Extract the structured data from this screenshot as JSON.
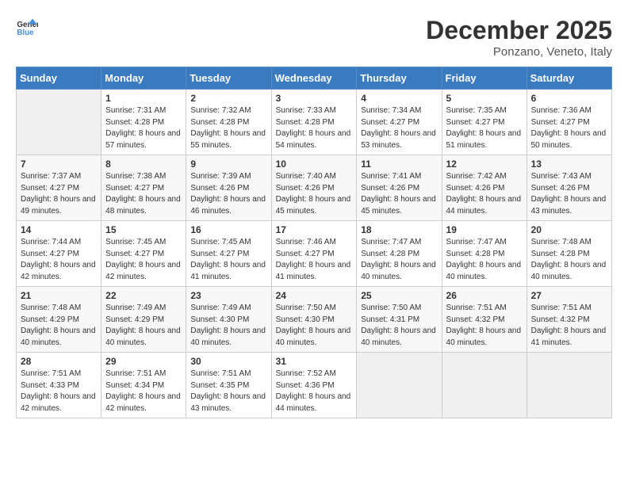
{
  "header": {
    "logo_general": "General",
    "logo_blue": "Blue",
    "month_title": "December 2025",
    "location": "Ponzano, Veneto, Italy"
  },
  "days_of_week": [
    "Sunday",
    "Monday",
    "Tuesday",
    "Wednesday",
    "Thursday",
    "Friday",
    "Saturday"
  ],
  "weeks": [
    [
      {
        "day": "",
        "sunrise": "",
        "sunset": "",
        "daylight": "",
        "empty": true
      },
      {
        "day": "1",
        "sunrise": "Sunrise: 7:31 AM",
        "sunset": "Sunset: 4:28 PM",
        "daylight": "Daylight: 8 hours and 57 minutes."
      },
      {
        "day": "2",
        "sunrise": "Sunrise: 7:32 AM",
        "sunset": "Sunset: 4:28 PM",
        "daylight": "Daylight: 8 hours and 55 minutes."
      },
      {
        "day": "3",
        "sunrise": "Sunrise: 7:33 AM",
        "sunset": "Sunset: 4:28 PM",
        "daylight": "Daylight: 8 hours and 54 minutes."
      },
      {
        "day": "4",
        "sunrise": "Sunrise: 7:34 AM",
        "sunset": "Sunset: 4:27 PM",
        "daylight": "Daylight: 8 hours and 53 minutes."
      },
      {
        "day": "5",
        "sunrise": "Sunrise: 7:35 AM",
        "sunset": "Sunset: 4:27 PM",
        "daylight": "Daylight: 8 hours and 51 minutes."
      },
      {
        "day": "6",
        "sunrise": "Sunrise: 7:36 AM",
        "sunset": "Sunset: 4:27 PM",
        "daylight": "Daylight: 8 hours and 50 minutes."
      }
    ],
    [
      {
        "day": "7",
        "sunrise": "Sunrise: 7:37 AM",
        "sunset": "Sunset: 4:27 PM",
        "daylight": "Daylight: 8 hours and 49 minutes."
      },
      {
        "day": "8",
        "sunrise": "Sunrise: 7:38 AM",
        "sunset": "Sunset: 4:27 PM",
        "daylight": "Daylight: 8 hours and 48 minutes."
      },
      {
        "day": "9",
        "sunrise": "Sunrise: 7:39 AM",
        "sunset": "Sunset: 4:26 PM",
        "daylight": "Daylight: 8 hours and 46 minutes."
      },
      {
        "day": "10",
        "sunrise": "Sunrise: 7:40 AM",
        "sunset": "Sunset: 4:26 PM",
        "daylight": "Daylight: 8 hours and 45 minutes."
      },
      {
        "day": "11",
        "sunrise": "Sunrise: 7:41 AM",
        "sunset": "Sunset: 4:26 PM",
        "daylight": "Daylight: 8 hours and 45 minutes."
      },
      {
        "day": "12",
        "sunrise": "Sunrise: 7:42 AM",
        "sunset": "Sunset: 4:26 PM",
        "daylight": "Daylight: 8 hours and 44 minutes."
      },
      {
        "day": "13",
        "sunrise": "Sunrise: 7:43 AM",
        "sunset": "Sunset: 4:26 PM",
        "daylight": "Daylight: 8 hours and 43 minutes."
      }
    ],
    [
      {
        "day": "14",
        "sunrise": "Sunrise: 7:44 AM",
        "sunset": "Sunset: 4:27 PM",
        "daylight": "Daylight: 8 hours and 42 minutes."
      },
      {
        "day": "15",
        "sunrise": "Sunrise: 7:45 AM",
        "sunset": "Sunset: 4:27 PM",
        "daylight": "Daylight: 8 hours and 42 minutes."
      },
      {
        "day": "16",
        "sunrise": "Sunrise: 7:45 AM",
        "sunset": "Sunset: 4:27 PM",
        "daylight": "Daylight: 8 hours and 41 minutes."
      },
      {
        "day": "17",
        "sunrise": "Sunrise: 7:46 AM",
        "sunset": "Sunset: 4:27 PM",
        "daylight": "Daylight: 8 hours and 41 minutes."
      },
      {
        "day": "18",
        "sunrise": "Sunrise: 7:47 AM",
        "sunset": "Sunset: 4:28 PM",
        "daylight": "Daylight: 8 hours and 40 minutes."
      },
      {
        "day": "19",
        "sunrise": "Sunrise: 7:47 AM",
        "sunset": "Sunset: 4:28 PM",
        "daylight": "Daylight: 8 hours and 40 minutes."
      },
      {
        "day": "20",
        "sunrise": "Sunrise: 7:48 AM",
        "sunset": "Sunset: 4:28 PM",
        "daylight": "Daylight: 8 hours and 40 minutes."
      }
    ],
    [
      {
        "day": "21",
        "sunrise": "Sunrise: 7:48 AM",
        "sunset": "Sunset: 4:29 PM",
        "daylight": "Daylight: 8 hours and 40 minutes."
      },
      {
        "day": "22",
        "sunrise": "Sunrise: 7:49 AM",
        "sunset": "Sunset: 4:29 PM",
        "daylight": "Daylight: 8 hours and 40 minutes."
      },
      {
        "day": "23",
        "sunrise": "Sunrise: 7:49 AM",
        "sunset": "Sunset: 4:30 PM",
        "daylight": "Daylight: 8 hours and 40 minutes."
      },
      {
        "day": "24",
        "sunrise": "Sunrise: 7:50 AM",
        "sunset": "Sunset: 4:30 PM",
        "daylight": "Daylight: 8 hours and 40 minutes."
      },
      {
        "day": "25",
        "sunrise": "Sunrise: 7:50 AM",
        "sunset": "Sunset: 4:31 PM",
        "daylight": "Daylight: 8 hours and 40 minutes."
      },
      {
        "day": "26",
        "sunrise": "Sunrise: 7:51 AM",
        "sunset": "Sunset: 4:32 PM",
        "daylight": "Daylight: 8 hours and 40 minutes."
      },
      {
        "day": "27",
        "sunrise": "Sunrise: 7:51 AM",
        "sunset": "Sunset: 4:32 PM",
        "daylight": "Daylight: 8 hours and 41 minutes."
      }
    ],
    [
      {
        "day": "28",
        "sunrise": "Sunrise: 7:51 AM",
        "sunset": "Sunset: 4:33 PM",
        "daylight": "Daylight: 8 hours and 42 minutes."
      },
      {
        "day": "29",
        "sunrise": "Sunrise: 7:51 AM",
        "sunset": "Sunset: 4:34 PM",
        "daylight": "Daylight: 8 hours and 42 minutes."
      },
      {
        "day": "30",
        "sunrise": "Sunrise: 7:51 AM",
        "sunset": "Sunset: 4:35 PM",
        "daylight": "Daylight: 8 hours and 43 minutes."
      },
      {
        "day": "31",
        "sunrise": "Sunrise: 7:52 AM",
        "sunset": "Sunset: 4:36 PM",
        "daylight": "Daylight: 8 hours and 44 minutes."
      },
      {
        "day": "",
        "sunrise": "",
        "sunset": "",
        "daylight": "",
        "empty": true
      },
      {
        "day": "",
        "sunrise": "",
        "sunset": "",
        "daylight": "",
        "empty": true
      },
      {
        "day": "",
        "sunrise": "",
        "sunset": "",
        "daylight": "",
        "empty": true
      }
    ]
  ]
}
